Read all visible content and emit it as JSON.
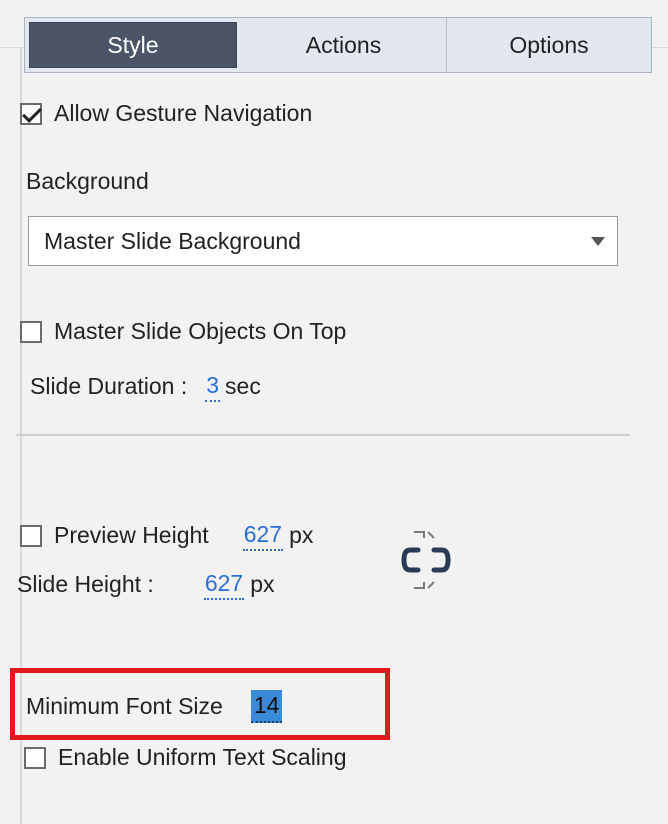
{
  "tabs": {
    "style": "Style",
    "actions": "Actions",
    "options": "Options"
  },
  "gesture": {
    "label": "Allow Gesture Navigation",
    "checked": true
  },
  "background": {
    "label": "Background",
    "value": "Master Slide Background"
  },
  "master_objects": {
    "label": "Master Slide Objects On Top",
    "checked": false
  },
  "slide_duration": {
    "label": "Slide Duration :",
    "value": "3",
    "unit": "sec"
  },
  "preview_height": {
    "label": "Preview Height",
    "value": "627",
    "unit": "px",
    "checked": false
  },
  "slide_height": {
    "label": "Slide Height :",
    "value": "627",
    "unit": "px"
  },
  "min_font": {
    "label": "Minimum Font Size",
    "value": "14"
  },
  "uniform_text": {
    "label": "Enable Uniform Text Scaling",
    "checked": false
  },
  "colors": {
    "highlight_border": "#e0191d",
    "link_value": "#2a6fd6",
    "active_tab": "#4b5567"
  },
  "icons": {
    "link": "unlink-chain-icon"
  }
}
